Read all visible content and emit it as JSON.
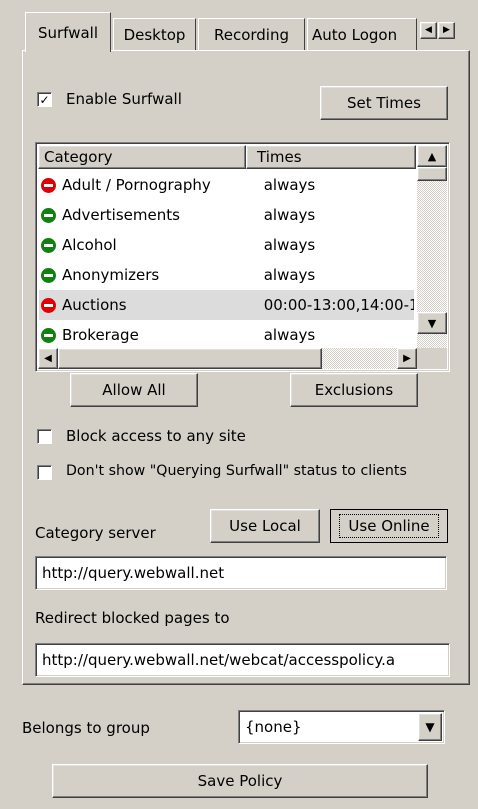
{
  "tabs": [
    "Surfwall",
    "Desktop",
    "Recording",
    "Auto Logon"
  ],
  "enable_surfwall": {
    "label": "Enable Surfwall",
    "checked": true
  },
  "set_times_label": "Set Times",
  "table": {
    "headers": [
      "Category",
      "Times"
    ],
    "rows": [
      {
        "category": "Adult / Pornography",
        "times": "always",
        "status": "blocked",
        "selected": false
      },
      {
        "category": "Advertisements",
        "times": "always",
        "status": "allowed",
        "selected": false
      },
      {
        "category": "Alcohol",
        "times": "always",
        "status": "allowed",
        "selected": false
      },
      {
        "category": "Anonymizers",
        "times": "always",
        "status": "allowed",
        "selected": false
      },
      {
        "category": "Auctions",
        "times": "00:00-13:00,14:00-1",
        "status": "blocked",
        "selected": true
      },
      {
        "category": "Brokerage",
        "times": "always",
        "status": "allowed",
        "selected": false
      }
    ]
  },
  "allow_all_label": "Allow All",
  "exclusions_label": "Exclusions",
  "block_access": {
    "label": "Block access to any site",
    "checked": false
  },
  "dont_show_status": {
    "label": "Don't show \"Querying Surfwall\" status to clients",
    "checked": false
  },
  "category_server_label": "Category server",
  "use_local_label": "Use Local",
  "use_online_label": "Use Online",
  "category_server_url": "http://query.webwall.net",
  "redirect_label": "Redirect blocked pages to",
  "redirect_url": "http://query.webwall.net/webcat/accesspolicy.a",
  "belongs_to_group_label": "Belongs to group",
  "group_value": "{none}",
  "save_policy_label": "Save Policy",
  "colors": {
    "blocked": "#e00000",
    "allowed": "#108010",
    "face": "#d4d0c8"
  }
}
